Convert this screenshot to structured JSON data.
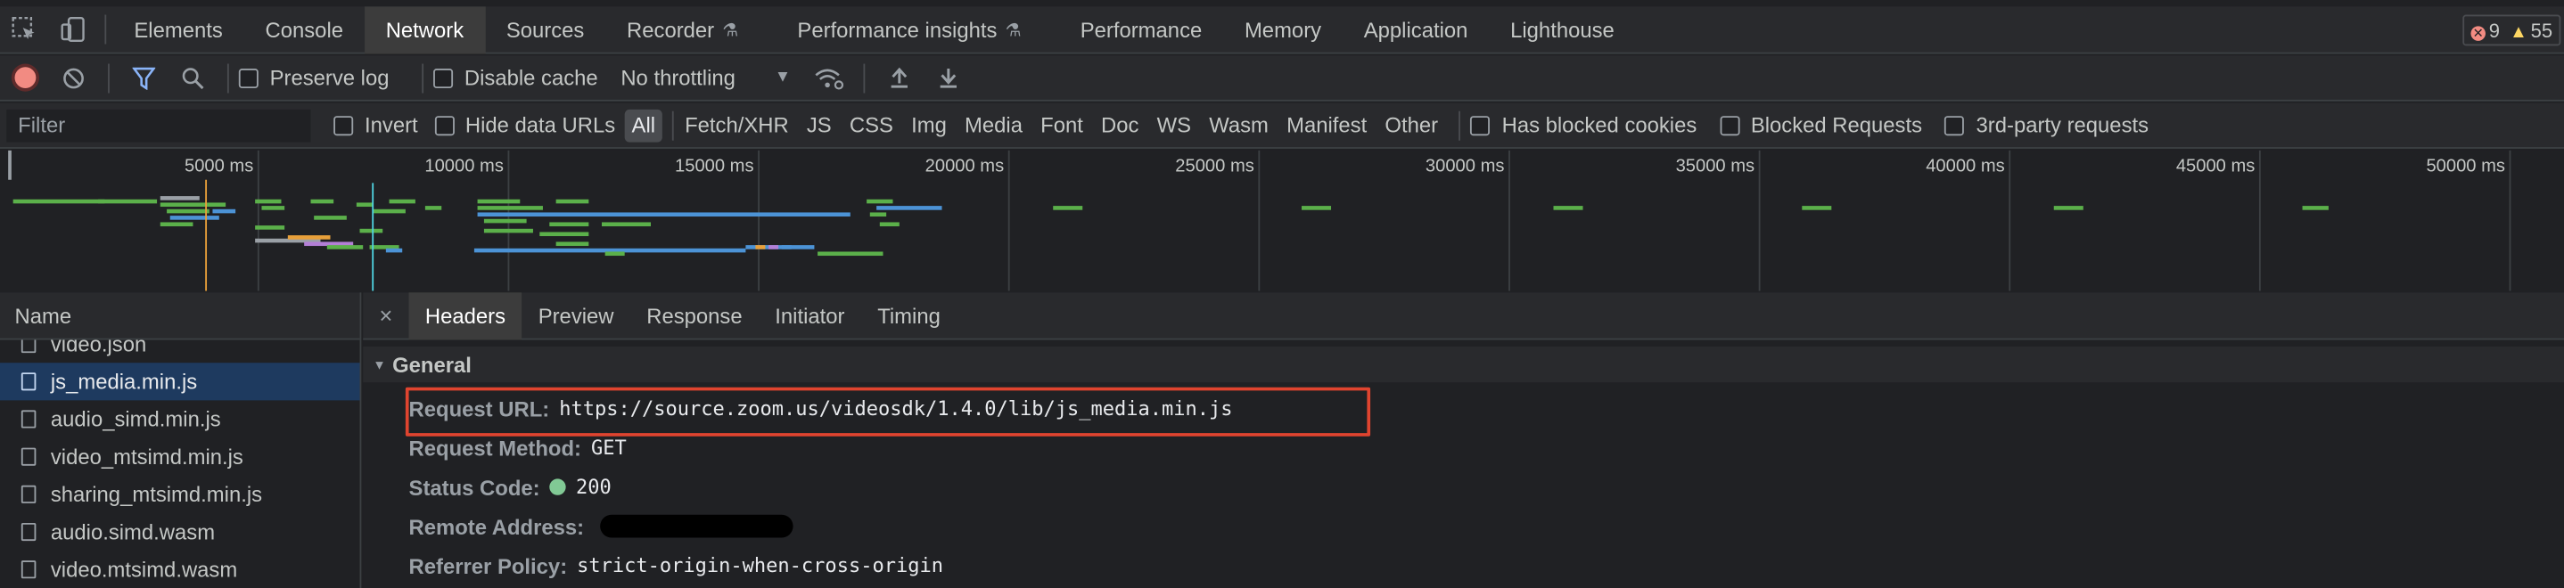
{
  "tabs": [
    {
      "label": "Elements",
      "active": false
    },
    {
      "label": "Console",
      "active": false
    },
    {
      "label": "Network",
      "active": true
    },
    {
      "label": "Sources",
      "active": false
    },
    {
      "label": "Recorder",
      "active": false,
      "icon": "flask-icon"
    },
    {
      "label": "Performance insights",
      "active": false,
      "icon": "flask-icon"
    },
    {
      "label": "Performance",
      "active": false
    },
    {
      "label": "Memory",
      "active": false
    },
    {
      "label": "Application",
      "active": false
    },
    {
      "label": "Lighthouse",
      "active": false
    }
  ],
  "issues": {
    "errors": "9",
    "warnings": "55"
  },
  "toolbar": {
    "preserve_log": "Preserve log",
    "disable_cache": "Disable cache",
    "throttling": "No throttling"
  },
  "filter": {
    "placeholder": "Filter",
    "invert": "Invert",
    "hide_data_urls": "Hide data URLs",
    "types": [
      "All",
      "Fetch/XHR",
      "JS",
      "CSS",
      "Img",
      "Media",
      "Font",
      "Doc",
      "WS",
      "Wasm",
      "Manifest",
      "Other"
    ],
    "active_type": "All",
    "has_blocked_cookies": "Has blocked cookies",
    "blocked_requests": "Blocked Requests",
    "third_party": "3rd-party requests"
  },
  "overview": {
    "ticks": [
      "5000 ms",
      "10000 ms",
      "15000 ms",
      "20000 ms",
      "25000 ms",
      "30000 ms",
      "35000 ms",
      "40000 ms",
      "45000 ms",
      "50000 ms"
    ]
  },
  "request_list": {
    "header": "Name",
    "items": [
      {
        "name": "video.json",
        "selected": false
      },
      {
        "name": "js_media.min.js",
        "selected": true
      },
      {
        "name": "audio_simd.min.js",
        "selected": false
      },
      {
        "name": "video_mtsimd.min.js",
        "selected": false
      },
      {
        "name": "sharing_mtsimd.min.js",
        "selected": false
      },
      {
        "name": "audio.simd.wasm",
        "selected": false
      },
      {
        "name": "video.mtsimd.wasm",
        "selected": false
      }
    ]
  },
  "detail": {
    "close": "×",
    "tabs": [
      "Headers",
      "Preview",
      "Response",
      "Initiator",
      "Timing"
    ],
    "active_tab": "Headers",
    "section": "General",
    "request_url_label": "Request URL:",
    "request_url": "https://source.zoom.us/videosdk/1.4.0/lib/js_media.min.js",
    "request_method_label": "Request Method:",
    "request_method": "GET",
    "status_code_label": "Status Code:",
    "status_code": "200",
    "remote_address_label": "Remote Address:",
    "referrer_policy_label": "Referrer Policy:",
    "referrer_policy": "strict-origin-when-cross-origin"
  },
  "colors": {
    "highlight": "#e0442f",
    "selected_row": "#1e3a5f",
    "record": "#f28b82",
    "status_ok": "#81c995"
  }
}
